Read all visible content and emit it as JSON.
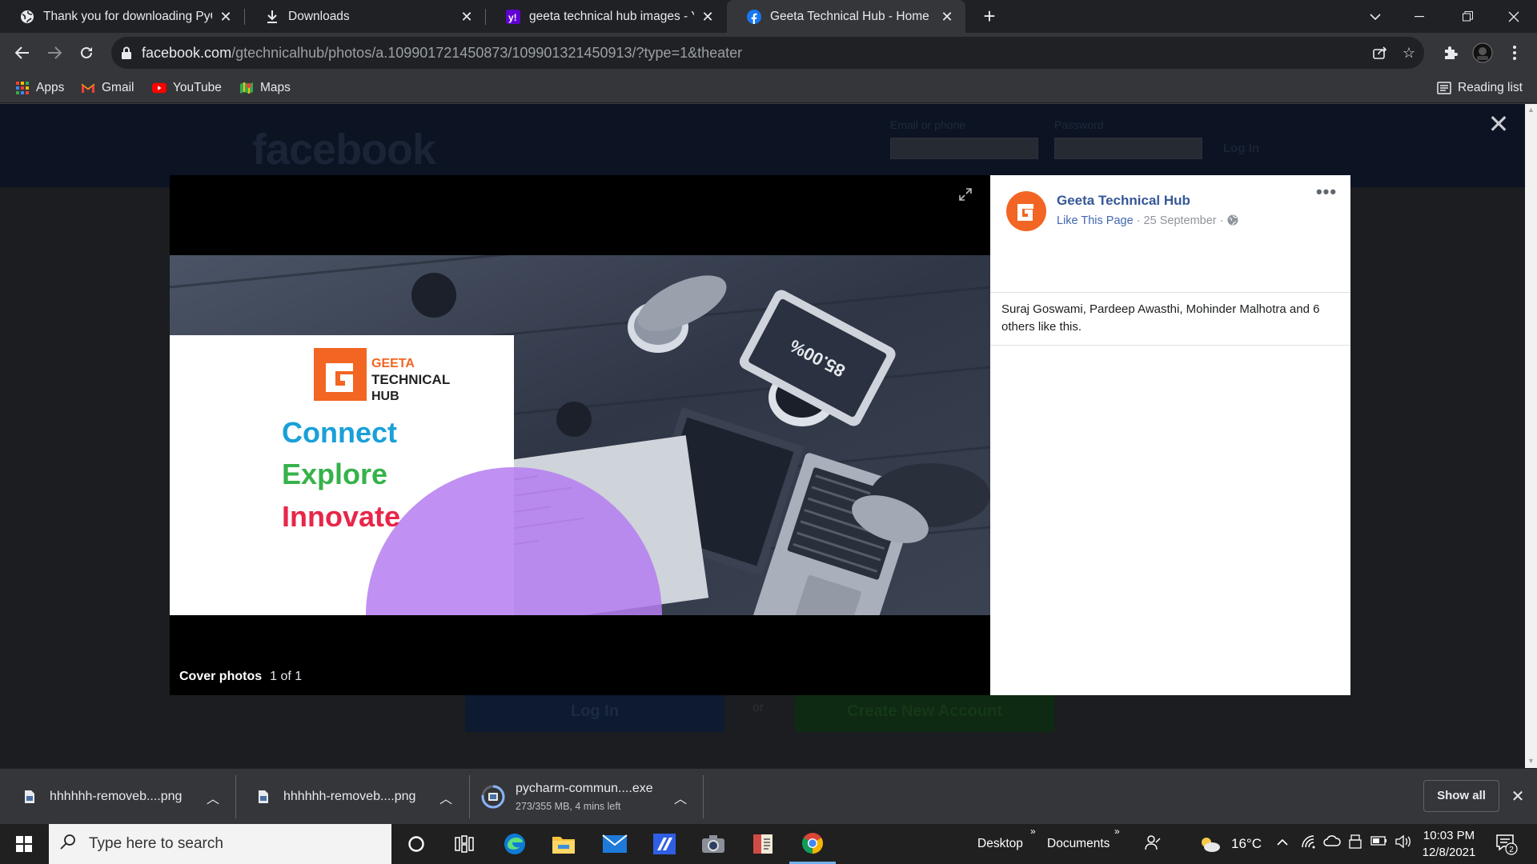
{
  "tabs": [
    {
      "label": "Thank you for downloading PyCh",
      "icon": "globe-icon"
    },
    {
      "label": "Downloads",
      "icon": "download-icon"
    },
    {
      "label": "geeta technical hub images - Yah",
      "icon": "yahoo-icon"
    },
    {
      "label": "Geeta Technical Hub - Home | Fa",
      "icon": "facebook-icon",
      "active": true
    }
  ],
  "address": {
    "domain": "facebook.com",
    "path": "/gtechnicalhub/photos/a.109901721450873/109901321450913/?type=1&theater"
  },
  "bookmarks": [
    {
      "label": "Apps",
      "icon": "apps-grid-icon"
    },
    {
      "label": "Gmail",
      "icon": "gmail-icon"
    },
    {
      "label": "YouTube",
      "icon": "youtube-icon"
    },
    {
      "label": "Maps",
      "icon": "maps-icon"
    }
  ],
  "reading_list": "Reading list",
  "fb_page": {
    "logo": "facebook",
    "email_label": "Email or phone",
    "password_label": "Password",
    "login_small": "Log In",
    "login_button": "Log In",
    "or": "or",
    "create_button": "Create New Account"
  },
  "photo": {
    "brand_line1": "GEETA",
    "brand_line2": "TECHNICAL",
    "brand_line3": "HUB",
    "word1": "Connect",
    "word2": "Explore",
    "word3": "Innovate",
    "tablet_text": "85.00%",
    "caption_album": "Cover photos",
    "caption_count": "1 of 1",
    "colors": {
      "connect": "#1aa0d8",
      "explore": "#36b24a",
      "innovate": "#e8264a",
      "accent": "#b57cf0",
      "orange": "#f26522"
    }
  },
  "side_panel": {
    "page_name": "Geeta Technical Hub",
    "like_link": "Like This Page",
    "date": "25 September",
    "likes_text": "Suraj Goswami, Pardeep Awasthi, Mohinder Malhotra and 6 others like this."
  },
  "downloads": [
    {
      "name": "hhhhhh-removeb....png",
      "sub": ""
    },
    {
      "name": "hhhhhh-removeb....png",
      "sub": ""
    },
    {
      "name": "pycharm-commun....exe",
      "sub": "273/355 MB, 4 mins left"
    }
  ],
  "show_all": "Show all",
  "taskbar": {
    "search_placeholder": "Type here to search",
    "desktop": "Desktop",
    "documents": "Documents",
    "temperature": "16°C",
    "time": "10:03 PM",
    "date": "12/8/2021",
    "notifications": "2"
  }
}
